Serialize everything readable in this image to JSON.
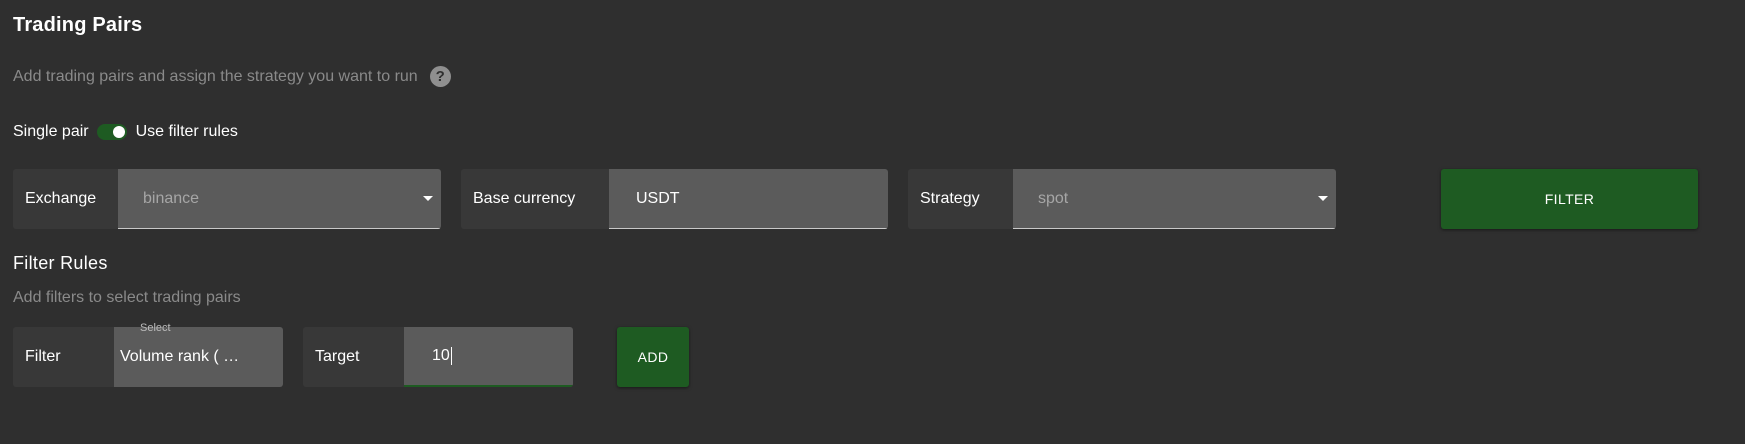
{
  "header": {
    "title": "Trading Pairs",
    "subtitle": "Add trading pairs and assign the strategy you want to run",
    "help_icon": "help-circle-icon"
  },
  "mode_toggle": {
    "left_label": "Single pair",
    "right_label": "Use filter rules",
    "checked": true
  },
  "pair_form": {
    "exchange": {
      "label": "Exchange",
      "value": "binance"
    },
    "base_currency": {
      "label": "Base currency",
      "value": "USDT"
    },
    "strategy": {
      "label": "Strategy",
      "value": "spot"
    },
    "filter_button": "FILTER"
  },
  "filter_rules": {
    "title": "Filter Rules",
    "subtitle": "Add filters to select trading pairs",
    "filter": {
      "label": "Filter",
      "float_label": "Select",
      "value": "Volume rank ( …"
    },
    "target": {
      "label": "Target",
      "value": "10"
    },
    "add_button": "ADD"
  },
  "colors": {
    "background": "#2f2f2f",
    "label_bg": "#383838",
    "input_bg": "#5b5b5b",
    "accent_green": "#1e5b22",
    "muted_text": "#8a8a8a"
  }
}
